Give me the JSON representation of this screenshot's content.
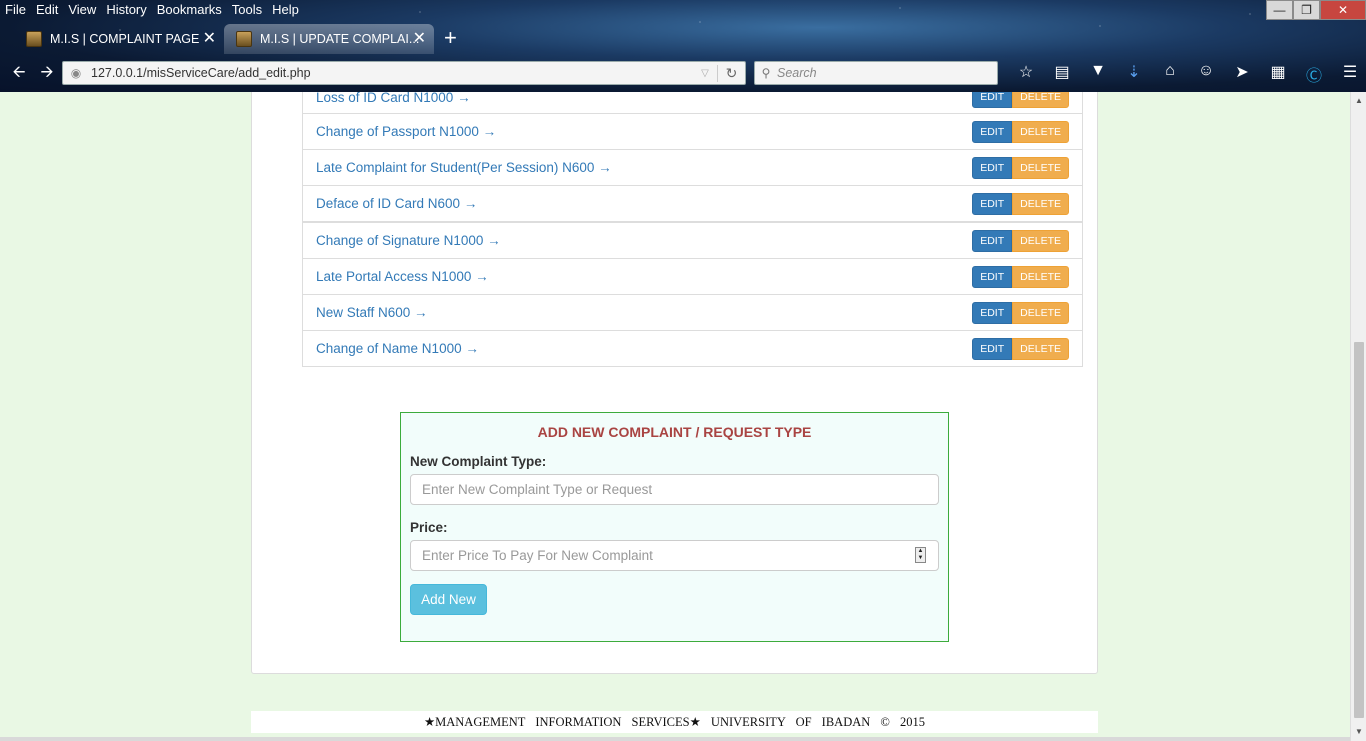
{
  "browser": {
    "menu": [
      "File",
      "Edit",
      "View",
      "History",
      "Bookmarks",
      "Tools",
      "Help"
    ],
    "tabs": [
      {
        "title": "M.I.S | COMPLAINT PAGE"
      },
      {
        "title": "M.I.S | UPDATE COMPLAI..."
      }
    ],
    "url": "127.0.0.1/misServiceCare/add_edit.php",
    "search_placeholder": "Search"
  },
  "complaint_types": [
    {
      "label": "Loss of ID Card N1000 →"
    },
    {
      "label": "Change of Passport N1000 →"
    },
    {
      "label": "Late Complaint for Student(Per Session) N600 →"
    },
    {
      "label": "Deface of ID Card N600 →"
    },
    {
      "label": "Change of Signature N1000 →"
    },
    {
      "label": "Late Portal Access N1000 →"
    },
    {
      "label": "New Staff N600 →"
    },
    {
      "label": "Change of Name N1000 →"
    }
  ],
  "actions": {
    "edit": "EDIT",
    "delete": "DELETE"
  },
  "add_form": {
    "title": "ADD NEW COMPLAINT / REQUEST TYPE",
    "type_label": "New Complaint Type:",
    "type_placeholder": "Enter New Complaint Type or Request",
    "price_label": "Price:",
    "price_placeholder": "Enter Price To Pay For New Complaint",
    "submit": "Add New"
  },
  "footer": "★MANAGEMENT INFORMATION SERVICES★ UNIVERSITY OF IBADAN © 2015",
  "colors": {
    "link": "#337ab7",
    "edit": "#337ab7",
    "delete": "#f0ad4e",
    "form_title": "#a94442",
    "form_border": "#3cab3c",
    "page_bg": "#e9f8e4"
  }
}
